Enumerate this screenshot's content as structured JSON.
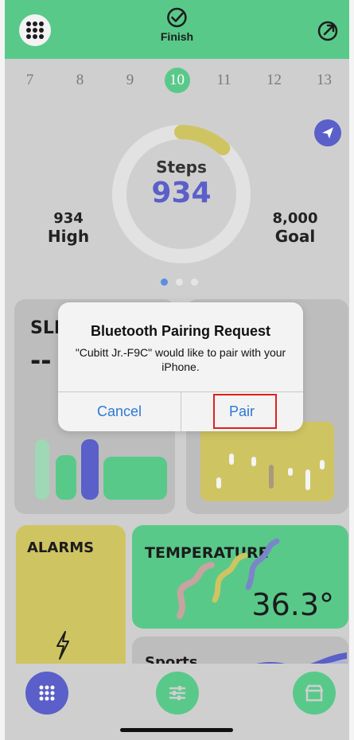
{
  "header": {
    "finish_label": "Finish"
  },
  "dates": [
    "7",
    "8",
    "9",
    "10",
    "11",
    "12",
    "13"
  ],
  "active_date": "10",
  "steps": {
    "title": "Steps",
    "value": "934",
    "progress": 0.117
  },
  "stats": {
    "high": {
      "num": "934",
      "label": "High"
    },
    "goal": {
      "num": "8,000",
      "label": "Goal"
    }
  },
  "cards": {
    "sleep": {
      "title": "SLE",
      "value": "--"
    },
    "alarms": {
      "title": "ALARMS"
    },
    "temperature": {
      "title": "TEMPERATURE",
      "value": "36.3°"
    },
    "sports": {
      "title": "Sports"
    }
  },
  "dialog": {
    "title": "Bluetooth Pairing Request",
    "message": "\"Cubitt Jr.-F9C\" would like to pair with your iPhone.",
    "cancel_label": "Cancel",
    "pair_label": "Pair"
  },
  "colors": {
    "accent_green": "#59c98a",
    "accent_purple": "#5b5fc9",
    "accent_yellow": "#cfc462",
    "highlight_red": "#e02020"
  },
  "icons": {
    "grid": "grid-icon",
    "finish": "check-circle-icon",
    "share": "share-icon",
    "send": "send-icon",
    "settings": "sliders-icon",
    "store": "store-icon"
  }
}
